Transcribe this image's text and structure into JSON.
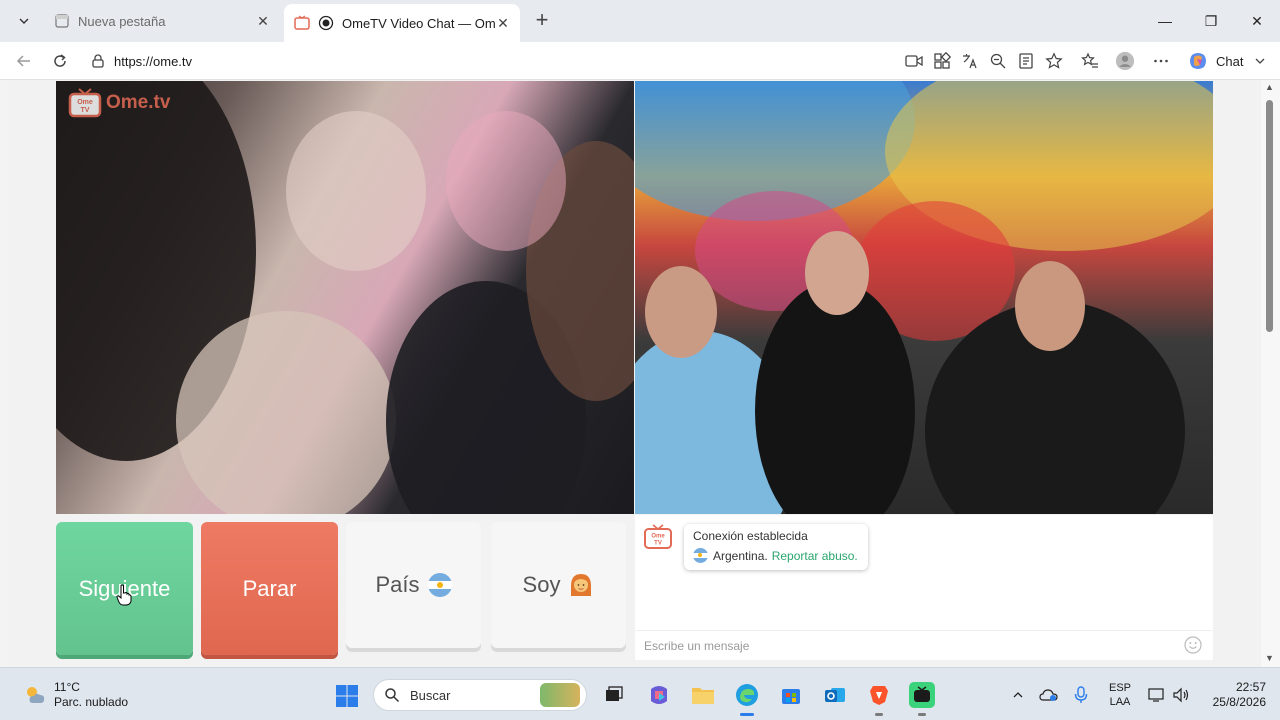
{
  "browser": {
    "tabs": [
      {
        "label": "Nueva pestaña",
        "close": "✕",
        "active": false
      },
      {
        "label": "OmeTV Video Chat — Omegle",
        "close": "✕",
        "active": true
      }
    ],
    "new_tab": "+",
    "url": "https://ome.tv",
    "chat_label": "Chat",
    "window": {
      "minimize": "—",
      "maximize": "❐",
      "close": "✕"
    }
  },
  "site": {
    "logo_text": "Ome.tv",
    "logo_badge": "Ome TV",
    "buttons": {
      "next": "Siguiente",
      "stop": "Parar",
      "country": "País",
      "gender": "Soy"
    },
    "chat": {
      "status": "Conexión establecida",
      "country": "Argentina.",
      "report": "Reportar abuso.",
      "placeholder": "Escribe un mensaje"
    }
  },
  "taskbar": {
    "weather": {
      "temp": "11°C",
      "condition": "Parc. nublado"
    },
    "search_label": "Buscar",
    "language": {
      "line1": "ESP",
      "line2": "LAA"
    },
    "clock": {
      "time": "22:57",
      "date": "25/8/2026"
    }
  },
  "colors": {
    "next_button": "#6fd6a0",
    "stop_button": "#ee7a63",
    "link_green": "#2aa56d",
    "logo_orange": "#e36a55"
  }
}
